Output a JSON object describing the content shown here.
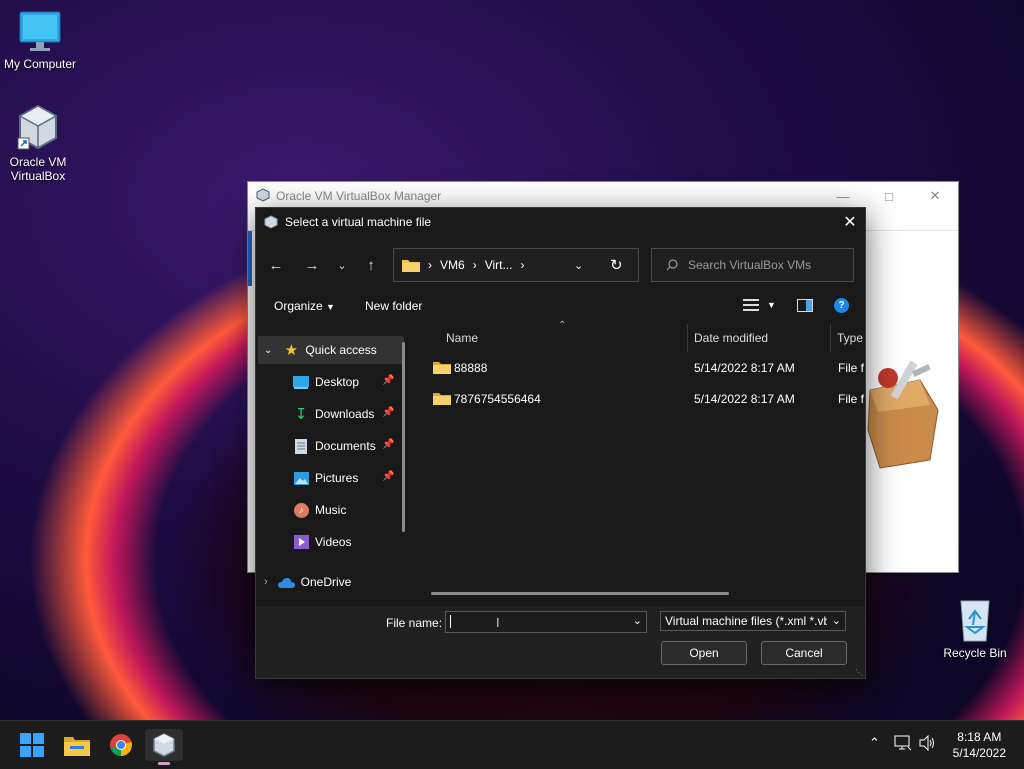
{
  "desktop": {
    "icons": [
      {
        "label": "My Computer"
      },
      {
        "label": "Oracle VM\nVirtualBox"
      },
      {
        "label": "Recycle Bin"
      }
    ]
  },
  "vbox_manager": {
    "title": "Oracle VM VirtualBox Manager"
  },
  "dialog": {
    "title": "Select a virtual machine file",
    "address": {
      "segments": [
        "VM6",
        "Virt..."
      ]
    },
    "search_placeholder": "Search VirtualBox VMs",
    "commands": {
      "organize": "Organize",
      "new_folder": "New folder"
    },
    "nav": {
      "quick_access": "Quick access",
      "items": [
        {
          "label": "Desktop",
          "pinned": true
        },
        {
          "label": "Downloads",
          "pinned": true
        },
        {
          "label": "Documents",
          "pinned": true
        },
        {
          "label": "Pictures",
          "pinned": true
        },
        {
          "label": "Music",
          "pinned": false
        },
        {
          "label": "Videos",
          "pinned": false
        }
      ],
      "onedrive": "OneDrive"
    },
    "columns": {
      "name": "Name",
      "date": "Date modified",
      "type": "Type"
    },
    "files": [
      {
        "name": "88888",
        "date": "5/14/2022 8:17 AM",
        "type": "File fo"
      },
      {
        "name": "7876754556464",
        "date": "5/14/2022 8:17 AM",
        "type": "File fo"
      }
    ],
    "file_name_label": "File name:",
    "file_name_value": "",
    "file_type": "Virtual machine files (*.xml *.vb",
    "open_label": "Open",
    "cancel_label": "Cancel"
  },
  "taskbar": {
    "time": "8:18 AM",
    "date": "5/14/2022"
  }
}
